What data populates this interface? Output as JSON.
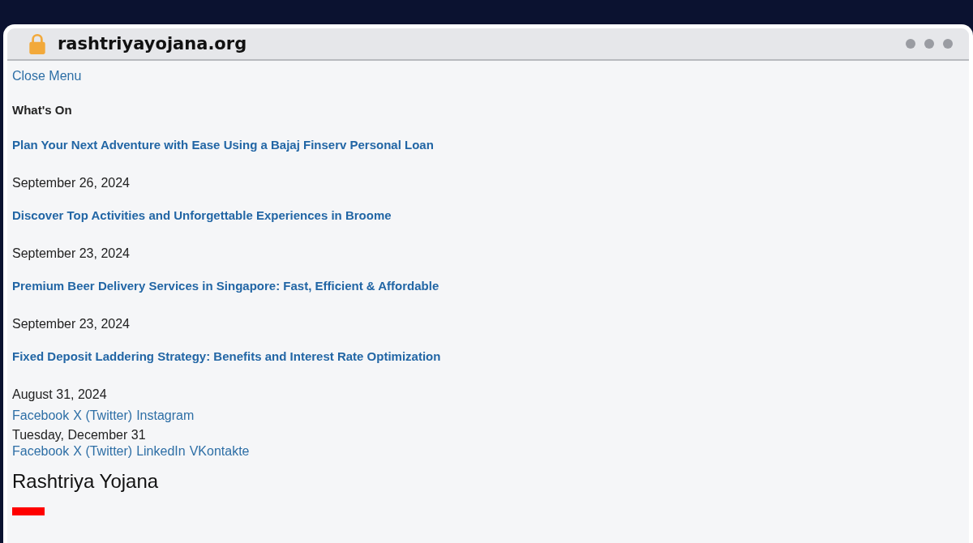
{
  "browser": {
    "url": "rashtriyayojana.org"
  },
  "page": {
    "close_menu": "Close Menu",
    "section_title": "What's On",
    "posts": [
      {
        "title": "Plan Your Next Adventure with Ease Using a Bajaj Finserv Personal Loan",
        "date": "September 26, 2024"
      },
      {
        "title": "Discover Top Activities and Unforgettable Experiences in Broome",
        "date": "September 23, 2024"
      },
      {
        "title": "Premium Beer Delivery Services in Singapore: Fast, Efficient & Affordable",
        "date": "September 23, 2024"
      },
      {
        "title": "Fixed Deposit Laddering Strategy: Benefits and Interest Rate Optimization",
        "date": "August 31, 2024"
      }
    ],
    "social_links_top": [
      "Facebook",
      "X (Twitter)",
      "Instagram"
    ],
    "current_date": "Tuesday, December 31",
    "social_links_bottom": [
      "Facebook",
      "X (Twitter)",
      "LinkedIn",
      "VKontakte"
    ],
    "site_name": "Rashtriya Yojana"
  }
}
